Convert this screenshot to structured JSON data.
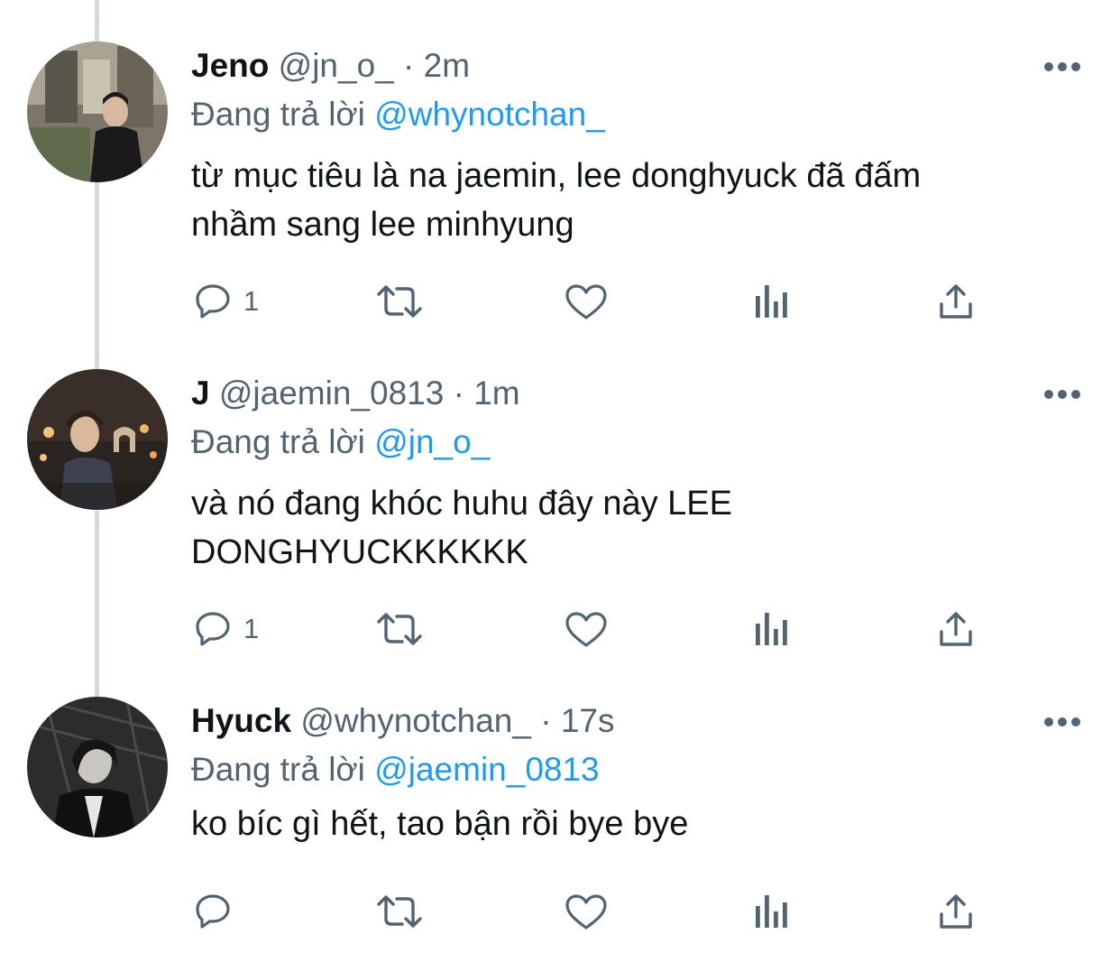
{
  "replying_label": "Đang trả lời",
  "tweets": [
    {
      "name": "Jeno",
      "handle": "@jn_o_",
      "separator": "·",
      "time": "2m",
      "reply_to": "@whynotchan_",
      "text_line1": "từ mục tiêu là na jaemin, lee donghyuck đã đấm",
      "text_line2": "nhầm sang lee minhyung",
      "reply_count": "1"
    },
    {
      "name": "J",
      "handle": "@jaemin_0813",
      "separator": "·",
      "time": "1m",
      "reply_to": "@jn_o_",
      "text_line1": "và nó đang khóc huhu đây này LEE",
      "text_line2": "DONGHYUCKKKKKK",
      "reply_count": "1"
    },
    {
      "name": "Hyuck",
      "handle": "@whynotchan_",
      "separator": "·",
      "time": "17s",
      "reply_to": "@jaemin_0813",
      "text_line1": "ko bíc gì hết, tao bận rồi bye bye",
      "text_line2": "",
      "reply_count": ""
    }
  ],
  "icons": {
    "reply": "speech-bubble-icon",
    "retweet": "retweet-arrows-icon",
    "like": "heart-icon",
    "views": "bar-chart-icon",
    "share": "share-upload-icon",
    "more": "more-dots-icon"
  },
  "colors": {
    "text": "#0f1419",
    "secondary": "#536471",
    "mention": "#1d9bf0",
    "thread_line": "#cfd9de"
  }
}
